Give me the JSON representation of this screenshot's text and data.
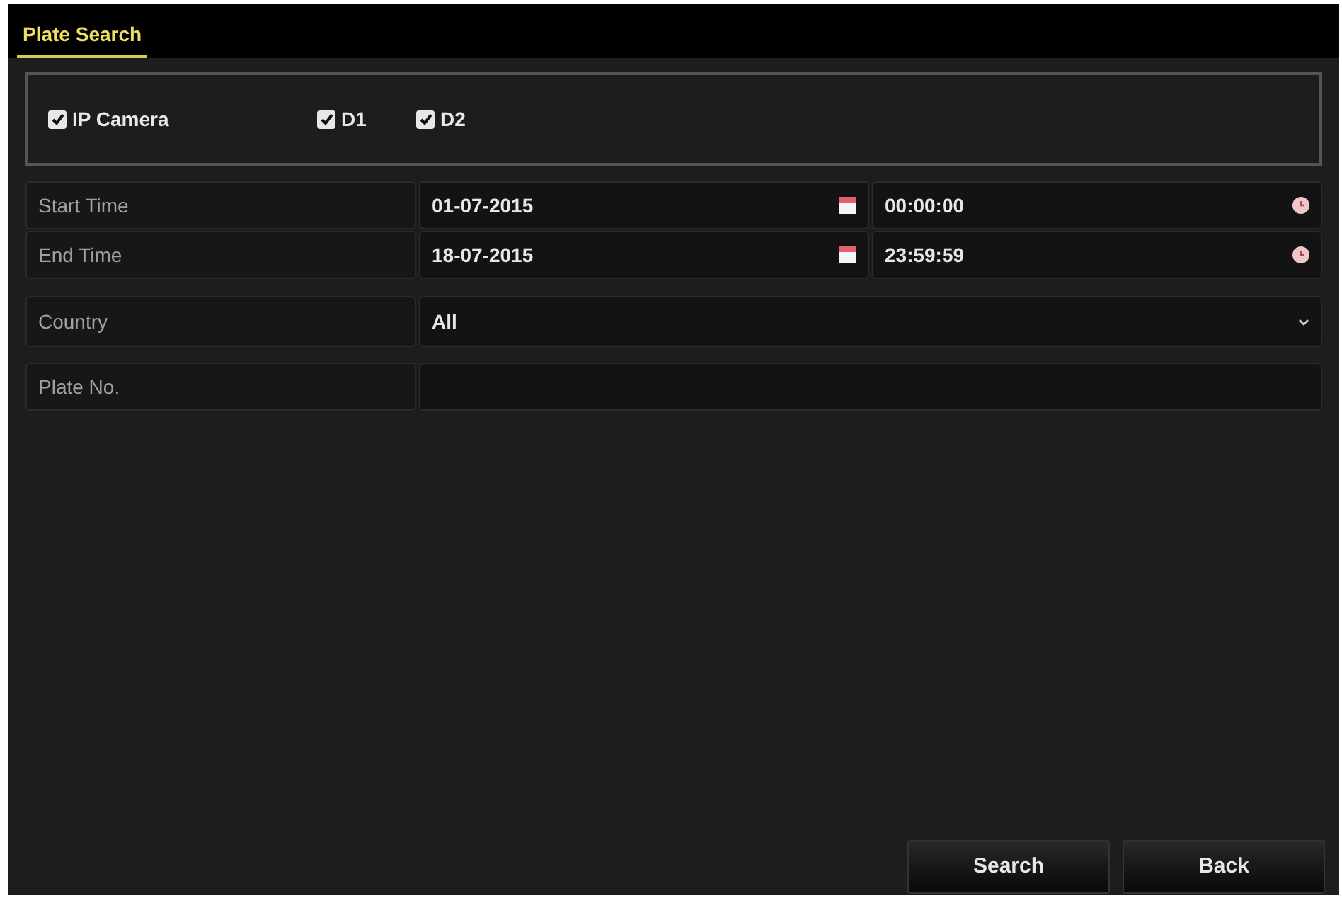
{
  "tabs": [
    {
      "label": "Plate Search",
      "selected": true
    }
  ],
  "cameras": [
    {
      "label": "IP Camera",
      "checked": true
    },
    {
      "label": "D1",
      "checked": true
    },
    {
      "label": "D2",
      "checked": true
    }
  ],
  "time_rows": [
    {
      "label": "Start Time",
      "date": "01-07-2015",
      "time": "00:00:00"
    },
    {
      "label": "End Time",
      "date": "18-07-2015",
      "time": "23:59:59"
    }
  ],
  "country": {
    "label": "Country",
    "value": "All"
  },
  "plate": {
    "label": "Plate No."
  },
  "buttons": [
    "Search",
    "Back"
  ]
}
